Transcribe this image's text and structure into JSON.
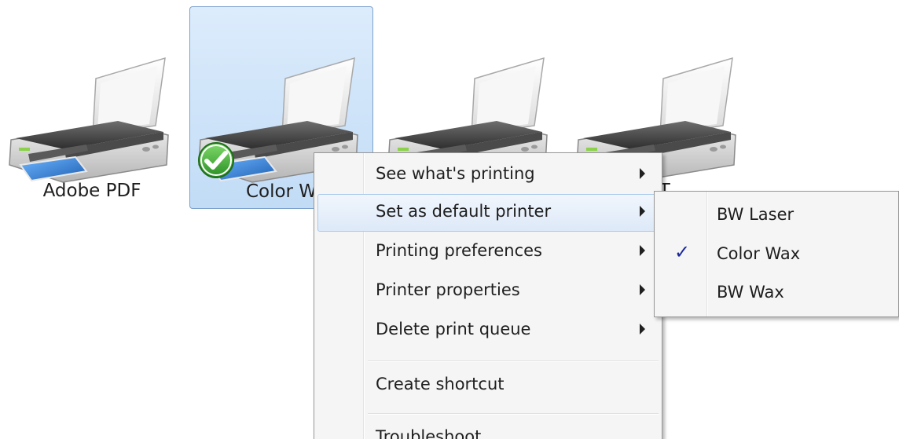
{
  "printers": [
    {
      "label": "Adobe PDF",
      "selected": false,
      "is_default": false
    },
    {
      "label": "Color W",
      "selected": true,
      "is_default": true
    },
    {
      "label": "",
      "selected": false,
      "is_default": false
    },
    {
      "label": "l T",
      "selected": false,
      "is_default": false
    }
  ],
  "context_menu": {
    "items": [
      {
        "label": "See what's printing",
        "has_submenu": true
      },
      {
        "label": "Set as default printer",
        "has_submenu": true,
        "highlighted": true
      },
      {
        "label": "Printing preferences",
        "has_submenu": true
      },
      {
        "label": "Printer properties",
        "has_submenu": true
      },
      {
        "label": "Delete print queue",
        "has_submenu": true
      },
      {
        "label": "Create shortcut",
        "has_submenu": false
      },
      {
        "label": "Troubleshoot",
        "has_submenu": false
      }
    ]
  },
  "submenu": {
    "items": [
      {
        "label": "BW Laser",
        "checked": false
      },
      {
        "label": "Color Wax",
        "checked": true,
        "check_glyph": "✓"
      },
      {
        "label": "BW Wax",
        "checked": false
      }
    ]
  },
  "colors": {
    "selection_border": "#7da2ce",
    "menu_background": "#f5f5f5",
    "check_color": "#1a2a9a",
    "default_badge": "#3aa835"
  }
}
